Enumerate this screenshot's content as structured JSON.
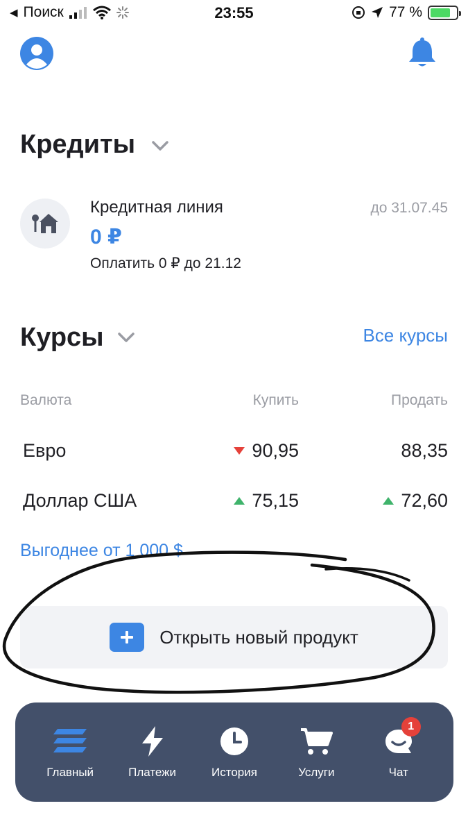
{
  "status_bar": {
    "back_app": "Поиск",
    "time": "23:55",
    "battery": "77 %",
    "battery_level": 0.77
  },
  "credits": {
    "title": "Кредиты",
    "item": {
      "name": "Кредитная линия",
      "until": "до 31.07.45",
      "amount": "0 ₽",
      "payment": "Оплатить 0 ₽ до 21.12"
    }
  },
  "rates": {
    "title": "Курсы",
    "all_link": "Все курсы",
    "columns": {
      "currency": "Валюта",
      "buy": "Купить",
      "sell": "Продать"
    },
    "rows": [
      {
        "currency": "Евро",
        "buy": "90,95",
        "buy_trend": "down",
        "sell": "88,35",
        "sell_trend": "none"
      },
      {
        "currency": "Доллар США",
        "buy": "75,15",
        "buy_trend": "up",
        "sell": "72,60",
        "sell_trend": "up"
      }
    ],
    "promo": "Выгоднее от 1 000 $"
  },
  "open_product": {
    "label": "Открыть новый продукт"
  },
  "tabbar": {
    "items": [
      {
        "label": "Главный",
        "icon": "menu-stack-icon"
      },
      {
        "label": "Платежи",
        "icon": "lightning-icon"
      },
      {
        "label": "История",
        "icon": "clock-icon"
      },
      {
        "label": "Услуги",
        "icon": "cart-icon"
      },
      {
        "label": "Чат",
        "icon": "chat-icon",
        "badge": "1"
      }
    ]
  },
  "colors": {
    "accent": "#3d86e3",
    "tabbar_bg": "#43506a",
    "down": "#e5413a",
    "up": "#3fb36b",
    "muted": "#9a9ca3"
  }
}
